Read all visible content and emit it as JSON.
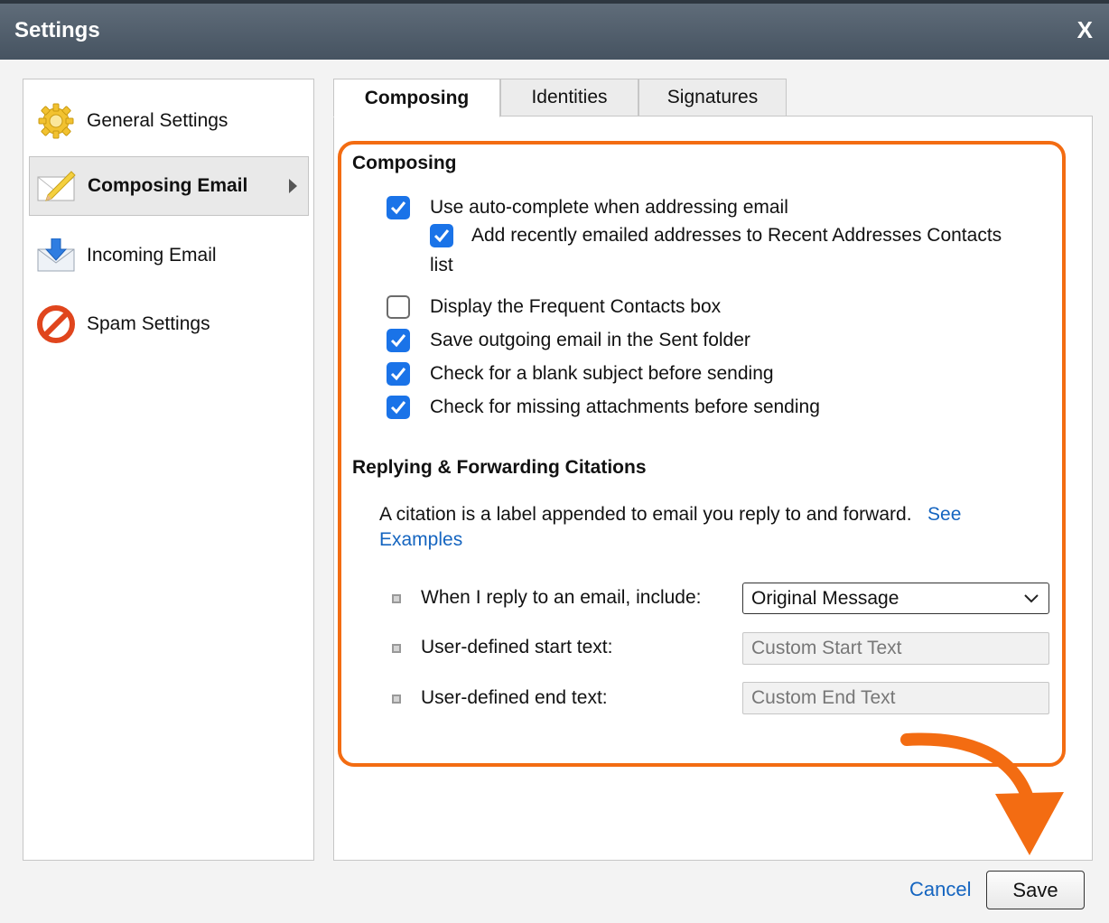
{
  "window": {
    "title": "Settings",
    "close_label": "X"
  },
  "sidebar": {
    "items": [
      {
        "label": "General Settings",
        "icon": "gear-icon",
        "active": false
      },
      {
        "label": "Composing Email",
        "icon": "envelope-pencil-icon",
        "active": true
      },
      {
        "label": "Incoming Email",
        "icon": "incoming-mail-icon",
        "active": false
      },
      {
        "label": "Spam Settings",
        "icon": "no-entry-icon",
        "active": false
      }
    ]
  },
  "tabs": [
    {
      "label": "Composing",
      "active": true
    },
    {
      "label": "Identities",
      "active": false
    },
    {
      "label": "Signatures",
      "active": false
    }
  ],
  "composing": {
    "title": "Composing",
    "options": [
      {
        "label": "Use auto-complete when addressing email",
        "checked": true
      },
      {
        "label_line1": "Add recently emailed addresses to Recent Addresses Contacts",
        "label_line2": "list",
        "checked": true
      },
      {
        "label": "Display the Frequent Contacts box",
        "checked": false
      },
      {
        "label": "Save outgoing email in the Sent folder",
        "checked": true
      },
      {
        "label": "Check for a blank subject before sending",
        "checked": true
      },
      {
        "label": "Check for missing attachments before sending",
        "checked": true
      }
    ]
  },
  "citations": {
    "title": "Replying & Forwarding Citations",
    "description": "A citation is a label appended to email you reply to and forward.",
    "link_see": "See",
    "link_examples": "Examples",
    "reply_label": "When I reply to an email, include:",
    "reply_value": "Original Message",
    "start_label": "User-defined start text:",
    "start_placeholder": "Custom Start Text",
    "end_label": "User-defined end text:",
    "end_placeholder": "Custom End Text"
  },
  "footer": {
    "cancel_label": "Cancel",
    "save_label": "Save"
  },
  "colors": {
    "accent": "#1a73e8",
    "annotation": "#f36c12",
    "titlebar": "#4f5b68"
  }
}
